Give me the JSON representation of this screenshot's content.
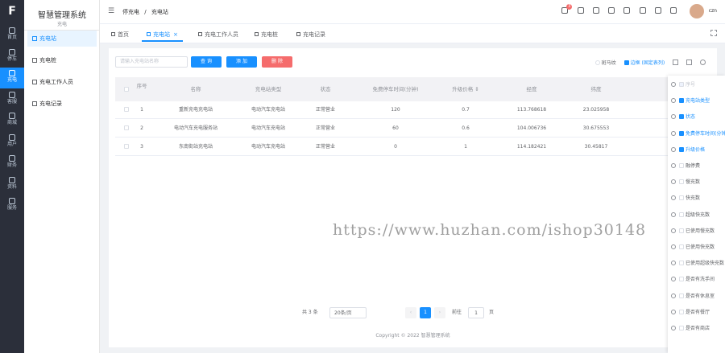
{
  "app": {
    "title": "智慧管理系统",
    "subtitle": "充电"
  },
  "rail": [
    {
      "label": "首页",
      "icon": "home-icon"
    },
    {
      "label": "停车",
      "icon": "car-icon"
    },
    {
      "label": "充电",
      "icon": "charge-icon",
      "active": true
    },
    {
      "label": "客服",
      "icon": "service-icon"
    },
    {
      "label": "商城",
      "icon": "shop-icon"
    },
    {
      "label": "用户",
      "icon": "user-icon"
    },
    {
      "label": "财务",
      "icon": "finance-icon"
    },
    {
      "label": "资料",
      "icon": "data-icon"
    },
    {
      "label": "服务",
      "icon": "server-icon"
    }
  ],
  "menu": [
    {
      "label": "充电站",
      "active": true
    },
    {
      "label": "充电桩"
    },
    {
      "label": "充电工作人员"
    },
    {
      "label": "充电记录"
    }
  ],
  "breadcrumb": [
    "停充电",
    "/",
    "充电站"
  ],
  "header": {
    "badge_count": "3",
    "user_name": "czn"
  },
  "tabs": [
    {
      "label": "首页"
    },
    {
      "label": "充电站",
      "close": "×",
      "active": true
    },
    {
      "label": "充电工作人员"
    },
    {
      "label": "充电桩"
    },
    {
      "label": "充电记录"
    }
  ],
  "toolbar": {
    "search_placeholder": "请输入充电站名称",
    "search_label": "查 询",
    "add_label": "添 加",
    "delete_label": "删 除",
    "zebra_label": "斑马纹",
    "fixed_label": "边框",
    "fixed_hint": "(固定表列)"
  },
  "table": {
    "columns": [
      "序号",
      "名称",
      "充电站类型",
      "状态",
      "免费停车时间(分钟)",
      "升级价格 ⇕",
      "经度",
      "纬度"
    ],
    "rows": [
      [
        "1",
        "重新充电充电站",
        "电动汽车充电站",
        "正常营业",
        "120",
        "0.7",
        "113.768618",
        "23.025958"
      ],
      [
        "2",
        "电动汽车充电服务站",
        "电动汽车充电站",
        "正常营业",
        "60",
        "0.6",
        "104.006736",
        "30.675553"
      ],
      [
        "3",
        "东南街站充电站",
        "电动汽车充电站",
        "正常营业",
        "0",
        "1",
        "114.182421",
        "30.45817"
      ]
    ]
  },
  "pager": {
    "total": "共 3 条",
    "page_size": "20条/页",
    "prev": "‹",
    "page": "1",
    "next": "›",
    "goto_label": "前往",
    "goto_value": "1",
    "page_unit": "页"
  },
  "footer": "Copyright © 2022 智慧管理系统",
  "column_panel": [
    {
      "label": "序号",
      "checked": true,
      "disabled": true
    },
    {
      "label": "充电站类型",
      "checked": true
    },
    {
      "label": "状态",
      "checked": true
    },
    {
      "label": "免费停车时间(分钟)",
      "checked": true
    },
    {
      "label": "升级价格",
      "checked": true
    },
    {
      "label": "融停费",
      "checked": false
    },
    {
      "label": "慢充数",
      "checked": false
    },
    {
      "label": "快充数",
      "checked": false
    },
    {
      "label": "超级快充数",
      "checked": false
    },
    {
      "label": "已使用慢充数",
      "checked": false
    },
    {
      "label": "已使用快充数",
      "checked": false
    },
    {
      "label": "已使用超级快充数",
      "checked": false
    },
    {
      "label": "是否有洗手间",
      "checked": false
    },
    {
      "label": "是否有休息室",
      "checked": false
    },
    {
      "label": "是否有餐厅",
      "checked": false
    },
    {
      "label": "是否有商店",
      "checked": false
    }
  ],
  "watermark": "https://www.huzhan.com/ishop30148",
  "colors": {
    "accent": "#1890ff",
    "danger": "#f56c6c",
    "rail": "#2b2f3a"
  }
}
